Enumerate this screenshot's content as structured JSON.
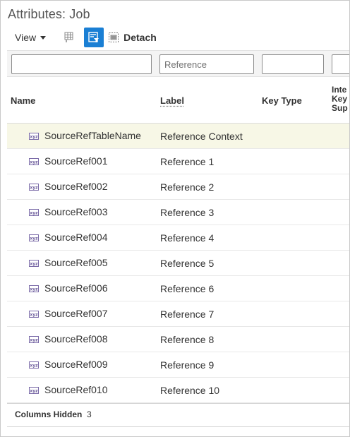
{
  "title": "Attributes: Job",
  "toolbar": {
    "view_label": "View",
    "detach_label": "Detach",
    "colors": {
      "active_button": "#1a7fd4"
    },
    "icons": [
      "freeze-columns-icon",
      "query-by-example-icon",
      "detach-icon"
    ]
  },
  "filters": [
    {
      "value": "",
      "placeholder": ""
    },
    {
      "value": "",
      "placeholder": "Reference"
    },
    {
      "value": "",
      "placeholder": ""
    },
    {
      "value": "",
      "placeholder": ""
    }
  ],
  "columns": {
    "name": "Name",
    "label": "Label",
    "key_type": "Key Type",
    "internal_key": [
      "Inte",
      "Key",
      "Sup"
    ]
  },
  "rows": [
    {
      "name": "SourceRefTableName",
      "label": "Reference Context",
      "selected": true
    },
    {
      "name": "SourceRef001",
      "label": "Reference 1"
    },
    {
      "name": "SourceRef002",
      "label": "Reference 2"
    },
    {
      "name": "SourceRef003",
      "label": "Reference 3"
    },
    {
      "name": "SourceRef004",
      "label": "Reference 4"
    },
    {
      "name": "SourceRef005",
      "label": "Reference 5"
    },
    {
      "name": "SourceRef006",
      "label": "Reference 6"
    },
    {
      "name": "SourceRef007",
      "label": "Reference 7"
    },
    {
      "name": "SourceRef008",
      "label": "Reference 8"
    },
    {
      "name": "SourceRef009",
      "label": "Reference 9"
    },
    {
      "name": "SourceRef010",
      "label": "Reference 10"
    }
  ],
  "row_icon": "xyz-attribute-icon",
  "footer": {
    "columns_hidden_label": "Columns Hidden",
    "columns_hidden_count": "3"
  }
}
